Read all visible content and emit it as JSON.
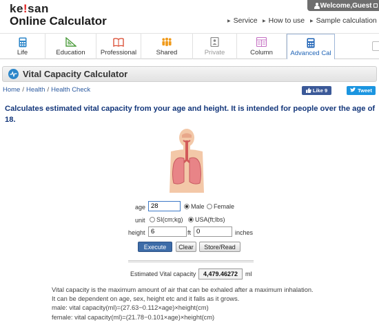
{
  "header": {
    "logo_top": "ke!san",
    "logo_bottom": "Online Calculator",
    "welcome": "Welcome,Guest",
    "nav": [
      {
        "label": "Service"
      },
      {
        "label": "How to use"
      },
      {
        "label": "Sample calculation"
      }
    ]
  },
  "categories": [
    {
      "label": "Life",
      "icon": "calculator-icon"
    },
    {
      "label": "Education",
      "icon": "triangle-ruler-icon"
    },
    {
      "label": "Professional",
      "icon": "book-icon"
    },
    {
      "label": "Shared",
      "icon": "people-icon"
    },
    {
      "label": "Private",
      "icon": "private-icon"
    },
    {
      "label": "Column",
      "icon": "column-icon"
    },
    {
      "label": "Advanced Cal",
      "icon": "advanced-calculator-icon"
    }
  ],
  "page": {
    "title": "Vital Capacity Calculator",
    "breadcrumb": [
      "Home",
      "Health",
      "Health Check"
    ],
    "like_label": "Like 9",
    "tweet_label": "Tweet",
    "description": "Calculates estimated vital capacity from your age and height. It is intended for people over the age of 18."
  },
  "form": {
    "age_label": "age",
    "age_value": "28",
    "sex_options": [
      {
        "label": "Male",
        "selected": true
      },
      {
        "label": "Female",
        "selected": false
      }
    ],
    "unit_label": "unit",
    "unit_options": [
      {
        "label": "SI(cm;kg)",
        "selected": false
      },
      {
        "label": "USA(ft;lbs)",
        "selected": true
      }
    ],
    "height_label": "height",
    "height_ft_value": "6",
    "ft_unit": "ft",
    "height_in_value": "0",
    "in_unit": "inches",
    "buttons": {
      "execute": "Execute",
      "clear": "Clear",
      "store_read": "Store/Read"
    },
    "result_label": "Estimated Vital capacity",
    "result_value": "4,479.46272",
    "result_unit": "ml"
  },
  "explanation": [
    "Vital capacity is the maximum amount of air that can be exhaled after a maximum inhalation.",
    "It can be dependent on age, sex, height etc and it falls as it grows.",
    "male: vital capacity(ml)=(27.63−0.112×age)×height(cm)",
    "female: vital capacity(ml)=(21.78−0.101×age)×height(cm)"
  ],
  "colors": {
    "brand_blue": "#13367a",
    "link_blue": "#2b5aa0",
    "execute_button": "#3d6ca8",
    "facebook": "#3b5998",
    "twitter": "#1b95e0"
  }
}
